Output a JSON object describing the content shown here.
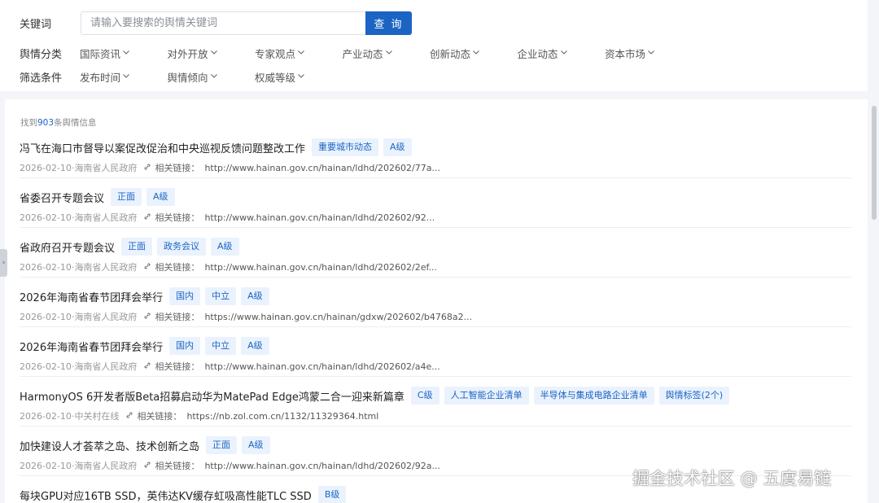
{
  "search": {
    "keyword_label": "关键词",
    "placeholder": "请输入要搜索的舆情关键词",
    "value": "",
    "button_label": "查 询"
  },
  "filters": {
    "category_label": "舆情分类",
    "categories": [
      "国际资讯",
      "对外开放",
      "专家观点",
      "产业动态",
      "创新动态",
      "企业动态",
      "资本市场"
    ],
    "condition_label": "筛选条件",
    "conditions": [
      "发布时间",
      "舆情倾向",
      "权威等级"
    ]
  },
  "results": {
    "found_prefix": "找到",
    "found_count": "903",
    "found_suffix": "条舆情信息",
    "link_label": "相关链接：",
    "items": [
      {
        "title": "冯飞在海口市督导以案促改促治和中央巡视反馈问题整改工作",
        "tags": [
          "重要城市动态",
          "A级"
        ],
        "date": "2026-02-10",
        "source": "海南省人民政府",
        "url": "http://www.hainan.gov.cn/hainan/ldhd/202602/77a..."
      },
      {
        "title": "省委召开专题会议",
        "tags": [
          "正面",
          "A级"
        ],
        "date": "2026-02-10",
        "source": "海南省人民政府",
        "url": "http://www.hainan.gov.cn/hainan/ldhd/202602/92..."
      },
      {
        "title": "省政府召开专题会议",
        "tags": [
          "正面",
          "政务会议",
          "A级"
        ],
        "date": "2026-02-10",
        "source": "海南省人民政府",
        "url": "http://www.hainan.gov.cn/hainan/ldhd/202602/2ef..."
      },
      {
        "title": "2026年海南省春节团拜会举行",
        "tags": [
          "国内",
          "中立",
          "A级"
        ],
        "date": "2026-02-10",
        "source": "海南省人民政府",
        "url": "https://www.hainan.gov.cn/hainan/gdxw/202602/b4768a2..."
      },
      {
        "title": "2026年海南省春节团拜会举行",
        "tags": [
          "国内",
          "中立",
          "A级"
        ],
        "date": "2026-02-10",
        "source": "海南省人民政府",
        "url": "http://www.hainan.gov.cn/hainan/ldhd/202602/a4e..."
      },
      {
        "title": "HarmonyOS 6开发者版Beta招募启动华为MatePad Edge鸿蒙二合一迎来新篇章",
        "tags": [
          "C级",
          "人工智能企业清单",
          "半导体与集成电路企业清单",
          "舆情标签(2个)"
        ],
        "date": "2026-02-10",
        "source": "中关村在线",
        "url": "https://nb.zol.com.cn/1132/11329364.html"
      },
      {
        "title": "加快建设人才荟萃之岛、技术创新之岛",
        "tags": [
          "正面",
          "A级"
        ],
        "date": "2026-02-10",
        "source": "海南省人民政府",
        "url": "http://www.hainan.gov.cn/hainan/ldhd/202602/92a..."
      },
      {
        "title": "每块GPU对应16TB SSD，英伟达KV缓存虹吸高性能TLC SSD",
        "tags": [
          "B级"
        ],
        "date": "",
        "source": "",
        "url": ""
      }
    ]
  },
  "watermark": "掘金技术社区 @ 五度易链",
  "collapse_glyph": "‹",
  "colors": {
    "accent": "#1b64c4",
    "tag_bg": "#eaf2fd"
  }
}
